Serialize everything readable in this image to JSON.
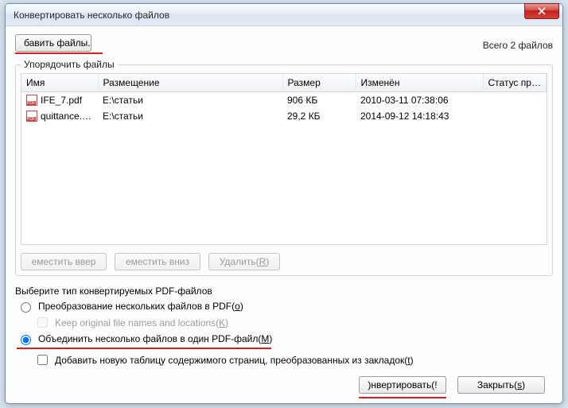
{
  "window": {
    "title": "Конвертировать несколько файлов"
  },
  "toolbar": {
    "add_files_label": "бавить файлы...",
    "total_label": "Всего 2 файлов"
  },
  "group": {
    "legend": "Упорядочить файлы"
  },
  "columns": {
    "name": "Имя",
    "location": "Размещение",
    "size": "Размер",
    "modified": "Изменён",
    "status": "Статус преоб..."
  },
  "rows": [
    {
      "name": "IFE_7.pdf",
      "location": "E:\\статьи",
      "size": "906 КБ",
      "modified": "2010-03-11 07:38:06",
      "status": ""
    },
    {
      "name": "quittance.pdf",
      "location": "E:\\статьи",
      "size": "29,2 КБ",
      "modified": "2014-09-12 14:18:43",
      "status": ""
    }
  ],
  "reorder": {
    "move_up": "еместить ввер",
    "move_down": "еместить вниз",
    "delete_label": "Удалить(",
    "delete_hotkey": "R",
    "delete_suffix": ")"
  },
  "types": {
    "caption": "Выберите тип конвертируемых PDF-файлов",
    "opt_multi": "Преобразование нескольких файлов в PDF(",
    "opt_multi_hotkey": "o",
    "opt_multi_suffix": ")",
    "keep_names": "Keep original file names and locations(",
    "keep_names_hotkey": "K",
    "keep_names_suffix": ")",
    "opt_merge": "Объединить несколько файлов в один PDF-файл(",
    "opt_merge_hotkey": "M",
    "opt_merge_suffix": ")",
    "add_toc": "Добавить новую таблицу содержимого страниц, преобразованных из закладок(",
    "add_toc_hotkey": "t",
    "add_toc_suffix": ")"
  },
  "footer": {
    "convert": ")нвертировать(!",
    "close_label": "Закрыть(",
    "close_hotkey": "s",
    "close_suffix": ")"
  }
}
